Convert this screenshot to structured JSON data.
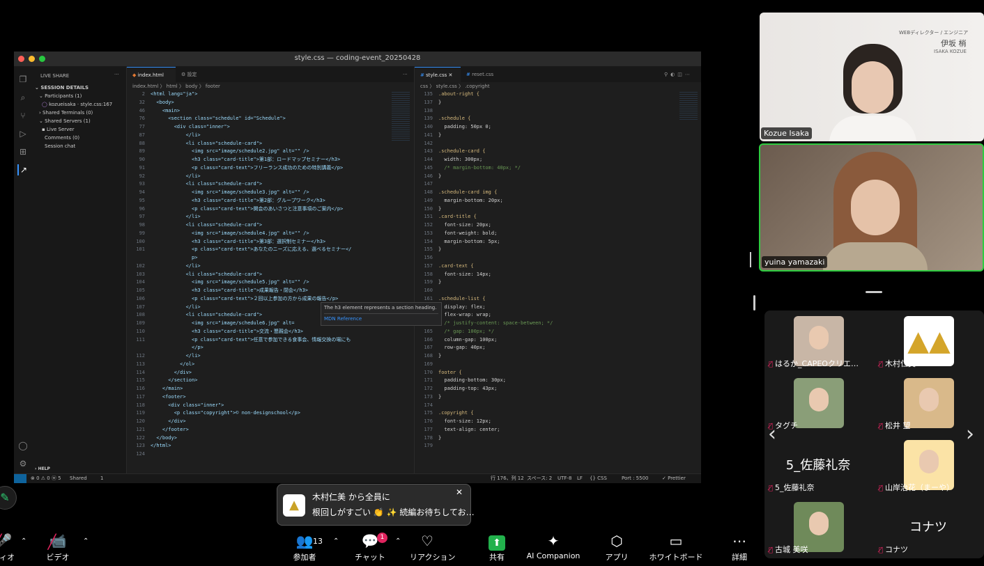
{
  "window": {
    "title": "style.css — coding-event_20250428"
  },
  "sidebar": {
    "header": "LIVE SHARE",
    "section": "SESSION DETAILS",
    "items": [
      "Participants (1)",
      "kozueisaka · style.css:167",
      "Shared Terminals (0)",
      "Shared Servers (1)",
      "Live Server",
      "Comments (0)",
      "Session chat"
    ],
    "help": "HELP"
  },
  "editor1": {
    "tabs": [
      "index.html",
      "設定"
    ],
    "breadcrumb": "index.html 〉 html 〉 body 〉 footer",
    "lines": [
      {
        "n": "2",
        "t": "<html lang=\"ja\">"
      },
      {
        "n": "32",
        "t": "  <body>"
      },
      {
        "n": "46",
        "t": "    <main>"
      },
      {
        "n": "76",
        "t": "      <section class=\"schedule\" id=\"Schedule\">"
      },
      {
        "n": "77",
        "t": "        <div class=\"inner\">"
      },
      {
        "n": "87",
        "t": "            </li>"
      },
      {
        "n": "88",
        "t": "            <li class=\"schedule-card\">"
      },
      {
        "n": "89",
        "t": "              <img src=\"image/schedule2.jpg\" alt=\"\" />"
      },
      {
        "n": "90",
        "t": "              <h3 class=\"card-title\">第1部：ロードマップセミナー</h3>"
      },
      {
        "n": "91",
        "t": "              <p class=\"card-text\">フリーランス成功のための特別講義</p>"
      },
      {
        "n": "92",
        "t": "            </li>"
      },
      {
        "n": "93",
        "t": "            <li class=\"schedule-card\">"
      },
      {
        "n": "94",
        "t": "              <img src=\"image/schedule3.jpg\" alt=\"\" />"
      },
      {
        "n": "95",
        "t": "              <h3 class=\"card-title\">第2部：グループワーク</h3>"
      },
      {
        "n": "96",
        "t": "              <p class=\"card-text\">開会のあいさつと注意事項のご案内</p>"
      },
      {
        "n": "97",
        "t": "            </li>"
      },
      {
        "n": "98",
        "t": "            <li class=\"schedule-card\">"
      },
      {
        "n": "99",
        "t": "              <img src=\"image/schedule4.jpg\" alt=\"\" />"
      },
      {
        "n": "100",
        "t": "              <h3 class=\"card-title\">第3部：選択制セミナー</h3>"
      },
      {
        "n": "101",
        "t": "              <p class=\"card-text\">あなたのニーズに応える、選べるセミナー</"
      },
      {
        "n": "",
        "t": "              p>"
      },
      {
        "n": "102",
        "t": "            </li>"
      },
      {
        "n": "103",
        "t": "            <li class=\"schedule-card\">"
      },
      {
        "n": "104",
        "t": "              <img src=\"image/schedule5.jpg\" alt=\"\" />"
      },
      {
        "n": "105",
        "t": "              <h3 class=\"card-title\">成果報告・閉会</h3>"
      },
      {
        "n": "106",
        "t": "              <p class=\"card-text\">２回以上参加の方から成果の報告</p>"
      },
      {
        "n": "107",
        "t": "            </li>"
      },
      {
        "n": "108",
        "t": "            <li class=\"schedule-card\">"
      },
      {
        "n": "109",
        "t": "              <img src=\"image/schedule6.jpg\" alt="
      },
      {
        "n": "110",
        "t": "              <h3 class=\"card-title\">交流・懇親会</h3>"
      },
      {
        "n": "111",
        "t": "              <p class=\"card-text\">任意で参加できる食事会、情報交換の場にも"
      },
      {
        "n": "",
        "t": "              </p>"
      },
      {
        "n": "112",
        "t": "            </li>"
      },
      {
        "n": "113",
        "t": "          </ol>"
      },
      {
        "n": "114",
        "t": "        </div>"
      },
      {
        "n": "115",
        "t": "      </section>"
      },
      {
        "n": "116",
        "t": "    </main>"
      },
      {
        "n": "117",
        "t": "    <footer>"
      },
      {
        "n": "118",
        "t": "      <div class=\"inner\">"
      },
      {
        "n": "119",
        "t": "        <p class=\"copyright\">© non-designschool</p>"
      },
      {
        "n": "120",
        "t": "      </div>"
      },
      {
        "n": "121",
        "t": "    </footer>"
      },
      {
        "n": "122",
        "t": "  </body>"
      },
      {
        "n": "123",
        "t": "</html>"
      },
      {
        "n": "124",
        "t": ""
      }
    ],
    "tooltip": {
      "text": "The h3 element represents a section heading.",
      "link": "MDN Reference"
    }
  },
  "editor2": {
    "tabs": [
      "style.css",
      "reset.css"
    ],
    "breadcrumb": "css 〉 style.css 〉 .copyright",
    "lines": [
      {
        "n": "135",
        "t": ".about-right {"
      },
      {
        "n": "137",
        "t": "}"
      },
      {
        "n": "138",
        "t": ""
      },
      {
        "n": "139",
        "t": ".schedule {"
      },
      {
        "n": "140",
        "t": "  padding: 50px 0;"
      },
      {
        "n": "141",
        "t": "}"
      },
      {
        "n": "142",
        "t": ""
      },
      {
        "n": "143",
        "t": ".schedule-card {"
      },
      {
        "n": "144",
        "t": "  width: 300px;"
      },
      {
        "n": "145",
        "t": "  /* margin-bottom: 40px; */"
      },
      {
        "n": "146",
        "t": "}"
      },
      {
        "n": "147",
        "t": ""
      },
      {
        "n": "148",
        "t": ".schedule-card img {"
      },
      {
        "n": "149",
        "t": "  margin-bottom: 20px;"
      },
      {
        "n": "150",
        "t": "}"
      },
      {
        "n": "151",
        "t": ".card-title {"
      },
      {
        "n": "152",
        "t": "  font-size: 20px;"
      },
      {
        "n": "153",
        "t": "  font-weight: bold;"
      },
      {
        "n": "154",
        "t": "  margin-bottom: 5px;"
      },
      {
        "n": "155",
        "t": "}"
      },
      {
        "n": "156",
        "t": ""
      },
      {
        "n": "157",
        "t": ".card-text {"
      },
      {
        "n": "158",
        "t": "  font-size: 14px;"
      },
      {
        "n": "159",
        "t": "}"
      },
      {
        "n": "160",
        "t": ""
      },
      {
        "n": "161",
        "t": ".schedule-list {"
      },
      {
        "n": "162",
        "t": "  display: flex;"
      },
      {
        "n": "163",
        "t": "  flex-wrap: wrap;"
      },
      {
        "n": "164",
        "t": "  /* justify-content: space-between; */"
      },
      {
        "n": "165",
        "t": "  /* gap: 100px; */"
      },
      {
        "n": "166",
        "t": "  column-gap: 100px;"
      },
      {
        "n": "167",
        "t": "  row-gap: 40px;"
      },
      {
        "n": "168",
        "t": "}"
      },
      {
        "n": "169",
        "t": ""
      },
      {
        "n": "170",
        "t": "footer {"
      },
      {
        "n": "171",
        "t": "  padding-bottom: 30px;"
      },
      {
        "n": "172",
        "t": "  padding-top: 43px;"
      },
      {
        "n": "173",
        "t": "}"
      },
      {
        "n": "174",
        "t": ""
      },
      {
        "n": "175",
        "t": ".copyright {"
      },
      {
        "n": "176",
        "t": "  font-size: 12px;"
      },
      {
        "n": "177",
        "t": "  text-align: center;"
      },
      {
        "n": "178",
        "t": "}"
      },
      {
        "n": "179",
        "t": ""
      }
    ]
  },
  "statusbar": {
    "left": [
      "⊗ 0 ⚠ 0 ⓦ 5",
      "Shared",
      "1"
    ],
    "right": [
      "行 176、列 12",
      "スペース: 2",
      "UTF-8",
      "LF",
      "{} CSS",
      "Port : 5500",
      "✓ Prettier"
    ]
  },
  "video": {
    "speaker1": {
      "name": "Kozue Isaka",
      "bg_title": "WEBディレクター / エンジニア",
      "bg_name": "伊坂 梢",
      "bg_roman": "ISAKA KOZUE"
    },
    "speaker2": {
      "name": "yuina yamazaki"
    }
  },
  "gallery": [
    {
      "name": "はるか_CAPEOクリエ…",
      "type": "photo",
      "color": "#c8b6a6"
    },
    {
      "name": "木村仁美",
      "type": "logo",
      "color": "#ffffff"
    },
    {
      "name": "タグチ",
      "type": "photo",
      "color": "#8a9e78"
    },
    {
      "name": "松井 望",
      "type": "photo",
      "color": "#d9b98a"
    },
    {
      "name": "5_佐藤礼奈",
      "type": "text",
      "label": "5_佐藤礼奈"
    },
    {
      "name": "山岸治花（まーや）",
      "type": "photo",
      "color": "#fbe3a6"
    },
    {
      "name": "古城 美咲",
      "type": "photo",
      "color": "#6f8a5a"
    },
    {
      "name": "コナツ",
      "type": "text",
      "label": "コナツ"
    }
  ],
  "chat_popup": {
    "from": "木村仁美 から全員に",
    "message": "根回しがすごい 👏 ✨ 続編お待ちしてお…"
  },
  "toolbar": {
    "items": [
      {
        "label": "ディオ"
      },
      {
        "label": "ビデオ"
      },
      {
        "label": "参加者",
        "count": "13"
      },
      {
        "label": "チャット",
        "badge": "1"
      },
      {
        "label": "リアクション"
      },
      {
        "label": "共有"
      },
      {
        "label": "AI Companion"
      },
      {
        "label": "アプリ"
      },
      {
        "label": "ホワイトボード"
      },
      {
        "label": "詳細"
      }
    ]
  },
  "colors": {
    "accent": "#3794ff",
    "active_speaker": "#2ecc40",
    "share_green": "#22b14c",
    "badge_red": "#e0245e"
  }
}
